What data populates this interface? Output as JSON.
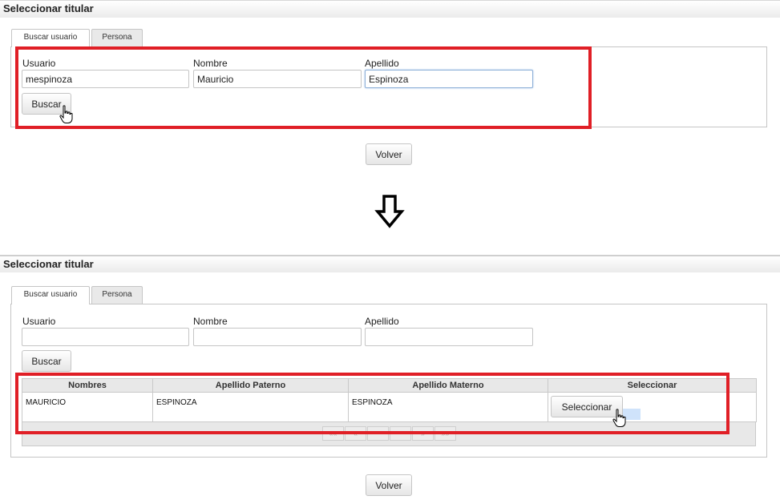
{
  "top": {
    "title": "Seleccionar titular",
    "tabs": [
      "Buscar usuario",
      "Persona"
    ],
    "fields": {
      "usuario_label": "Usuario",
      "nombre_label": "Nombre",
      "apellido_label": "Apellido",
      "usuario_value": "mespinoza",
      "nombre_value": "Mauricio",
      "apellido_value": "Espinoza"
    },
    "search_button": "Buscar",
    "back_button": "Volver"
  },
  "bottom": {
    "title": "Seleccionar titular",
    "tabs": [
      "Buscar usuario",
      "Persona"
    ],
    "fields": {
      "usuario_label": "Usuario",
      "nombre_label": "Nombre",
      "apellido_label": "Apellido",
      "usuario_value": "",
      "nombre_value": "",
      "apellido_value": ""
    },
    "search_button": "Buscar",
    "table": {
      "headers": [
        "Nombres",
        "Apellido Paterno",
        "Apellido Materno",
        "Seleccionar"
      ],
      "rows": [
        {
          "nombres": "MAURICIO",
          "apellido_paterno": "ESPINOZA",
          "apellido_materno": "ESPINOZA",
          "action": "Seleccionar"
        }
      ],
      "pager": [
        "««",
        "«",
        "",
        "",
        "»",
        "»»"
      ]
    },
    "back_button": "Volver"
  },
  "colors": {
    "highlight": "#e01f26",
    "focus": "#8eb0d8"
  },
  "icons": [
    "hand-pointer-icon",
    "down-arrow-icon"
  ]
}
